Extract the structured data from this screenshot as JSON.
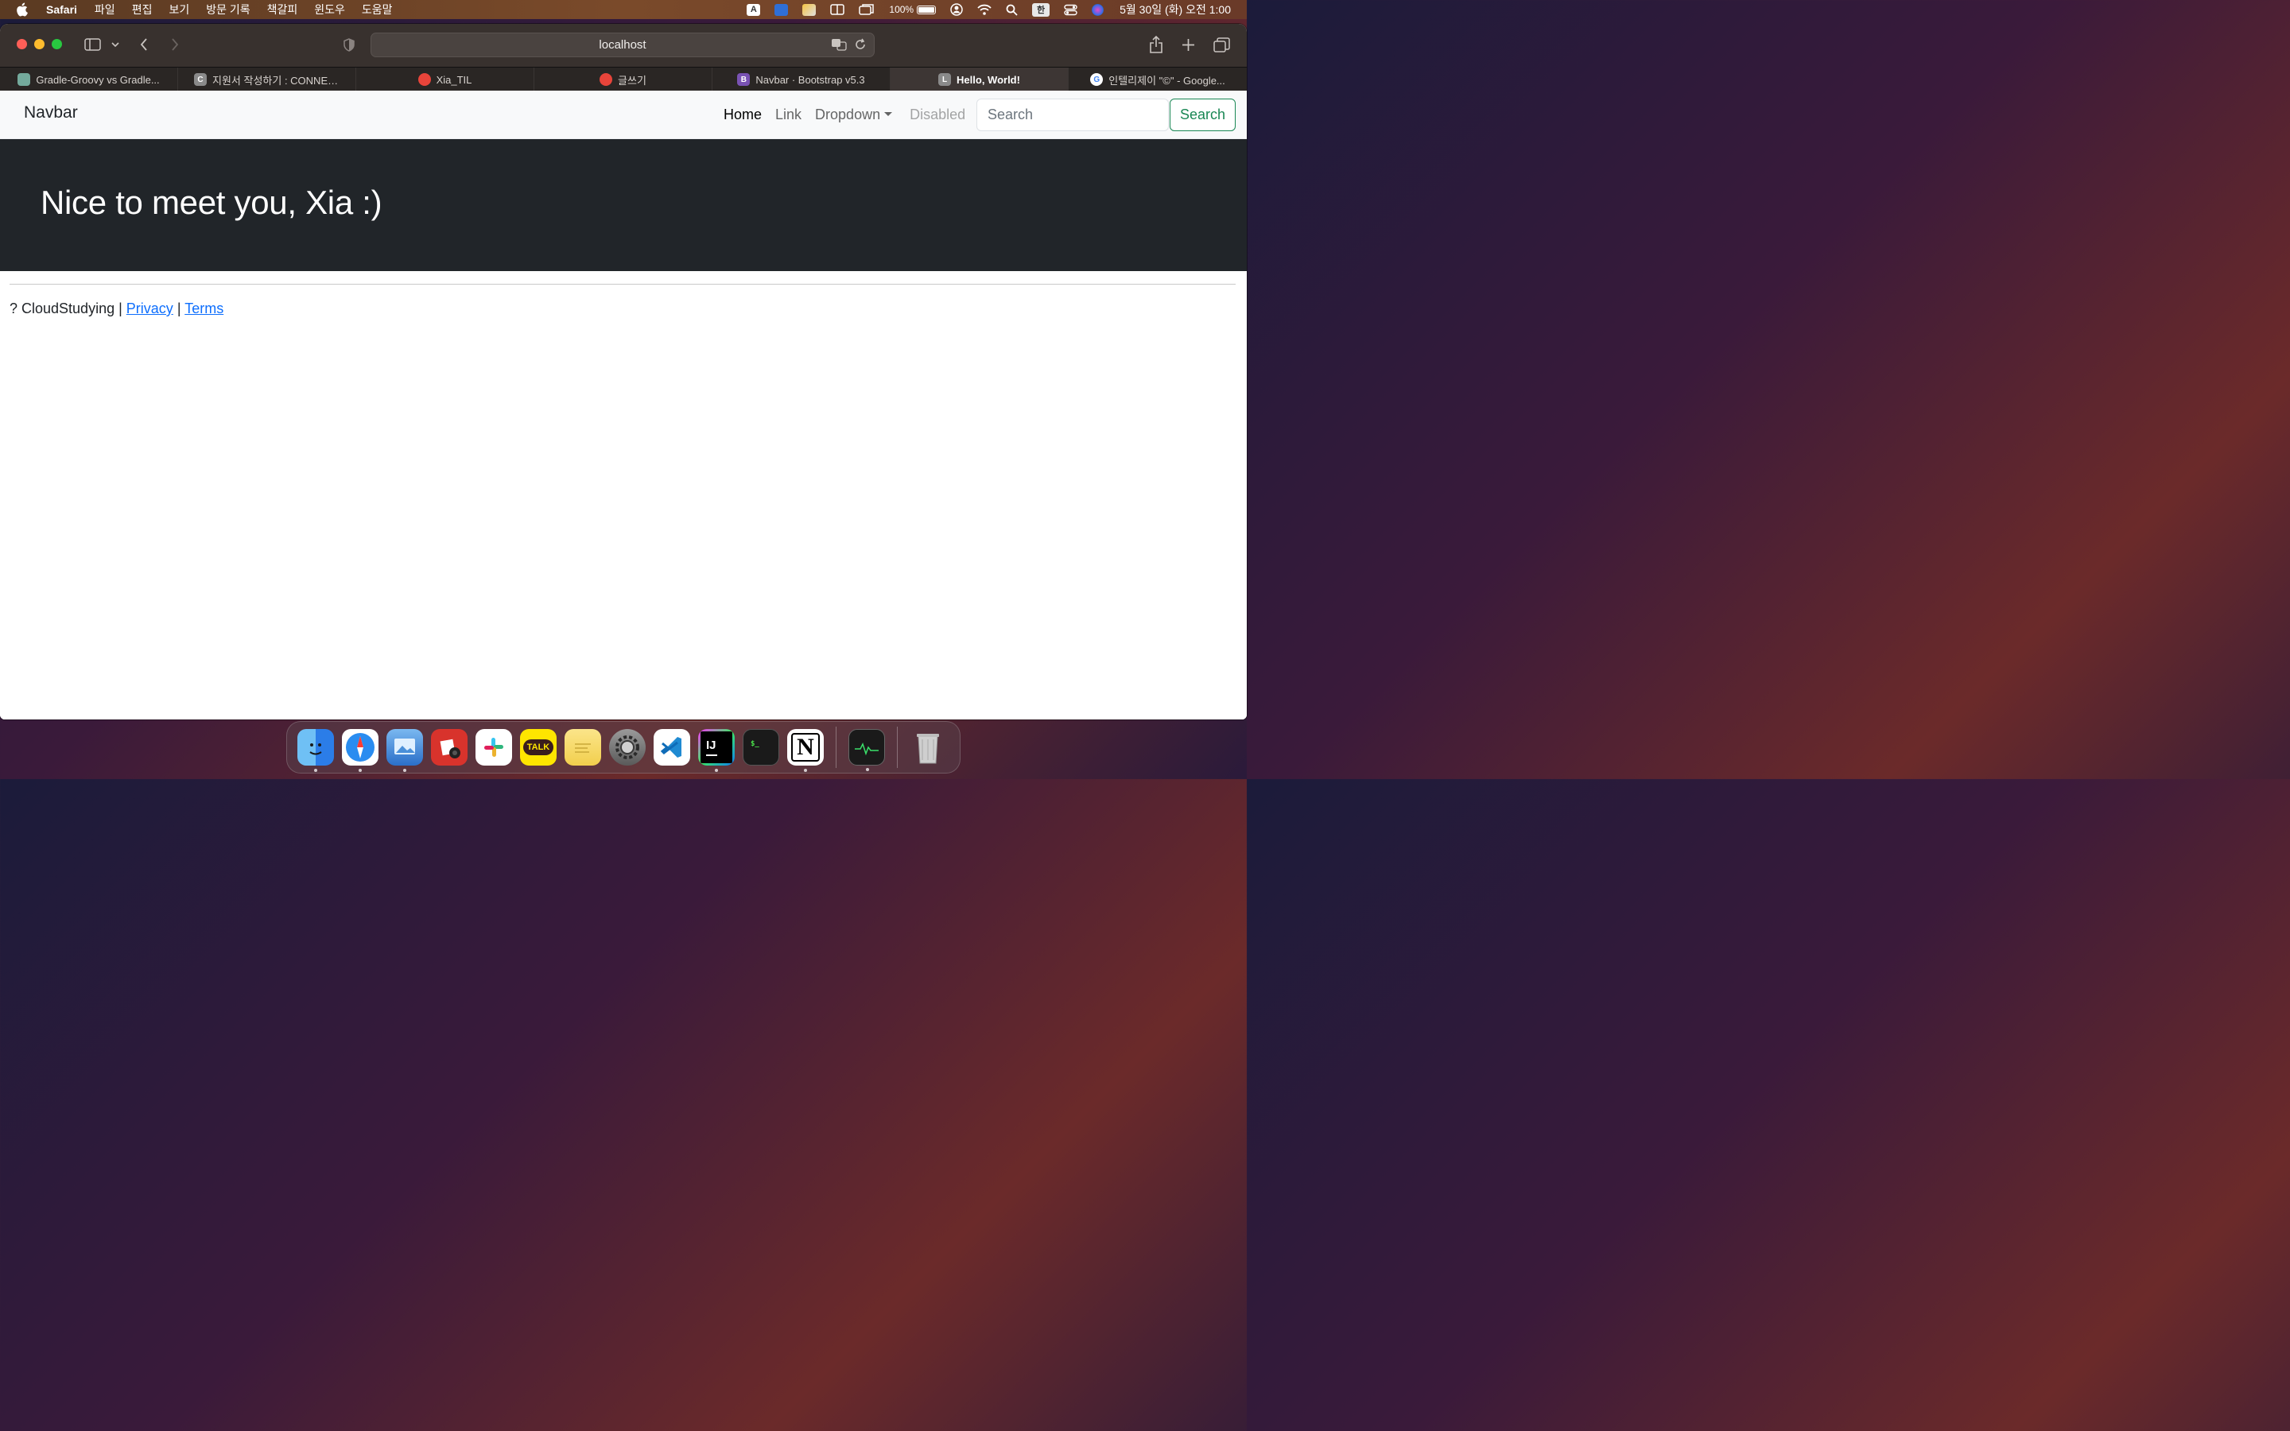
{
  "menubar": {
    "app_name": "Safari",
    "menus": [
      "파일",
      "편집",
      "보기",
      "방문 기록",
      "책갈피",
      "윈도우",
      "도움말"
    ],
    "battery_percent": "100%",
    "input_method": "한",
    "clock": "5월 30일 (화) 오전 1:00"
  },
  "browser": {
    "url": "localhost",
    "tabs": [
      {
        "label": "Gradle-Groovy vs Gradle...",
        "favicon_color": "#74aa9c",
        "favicon_letter": ""
      },
      {
        "label": "지원서 작성하기 : CONNEC...",
        "favicon_color": "#8a8a8a",
        "favicon_letter": "C"
      },
      {
        "label": "Xia_TIL",
        "favicon_color": "#e8443a",
        "favicon_letter": ""
      },
      {
        "label": "글쓰기",
        "favicon_color": "#e8443a",
        "favicon_letter": ""
      },
      {
        "label": "Navbar · Bootstrap v5.3",
        "favicon_color": "#7952b3",
        "favicon_letter": "B"
      },
      {
        "label": "Hello, World!",
        "favicon_color": "#8a8a8a",
        "favicon_letter": "L"
      },
      {
        "label": "인텔리제이 \"©\" - Google...",
        "favicon_color": "#ffffff",
        "favicon_letter": "G"
      }
    ],
    "active_tab_index": 5
  },
  "page": {
    "navbar": {
      "brand": "Navbar",
      "links": {
        "home": "Home",
        "link": "Link",
        "dropdown": "Dropdown",
        "disabled": "Disabled"
      },
      "search_placeholder": "Search",
      "search_button": "Search"
    },
    "hero": {
      "heading": "Nice to meet you, Xia :)"
    },
    "footer": {
      "prefix": "? CloudStudying |",
      "privacy": "Privacy",
      "separator": "|",
      "terms": "Terms"
    }
  },
  "dock": {
    "apps": [
      {
        "name": "finder",
        "running": true
      },
      {
        "name": "safari",
        "running": true
      },
      {
        "name": "preview",
        "running": true
      },
      {
        "name": "photo-booth",
        "running": false
      },
      {
        "name": "slack",
        "running": false
      },
      {
        "name": "kakaotalk",
        "running": false,
        "label": "TALK"
      },
      {
        "name": "stickies",
        "running": false
      },
      {
        "name": "system-settings",
        "running": false
      },
      {
        "name": "vscode",
        "running": false
      },
      {
        "name": "intellij",
        "running": true,
        "label": "IJ"
      },
      {
        "name": "terminal",
        "running": false
      },
      {
        "name": "notion",
        "running": true,
        "label": "N"
      },
      {
        "name": "activity-monitor",
        "running": true
      },
      {
        "name": "trash",
        "running": false
      }
    ]
  },
  "colors": {
    "accent_success": "#198754",
    "link": "#0d6efd",
    "hero_bg": "#212529",
    "navbar_bg": "#f8f9fa"
  }
}
